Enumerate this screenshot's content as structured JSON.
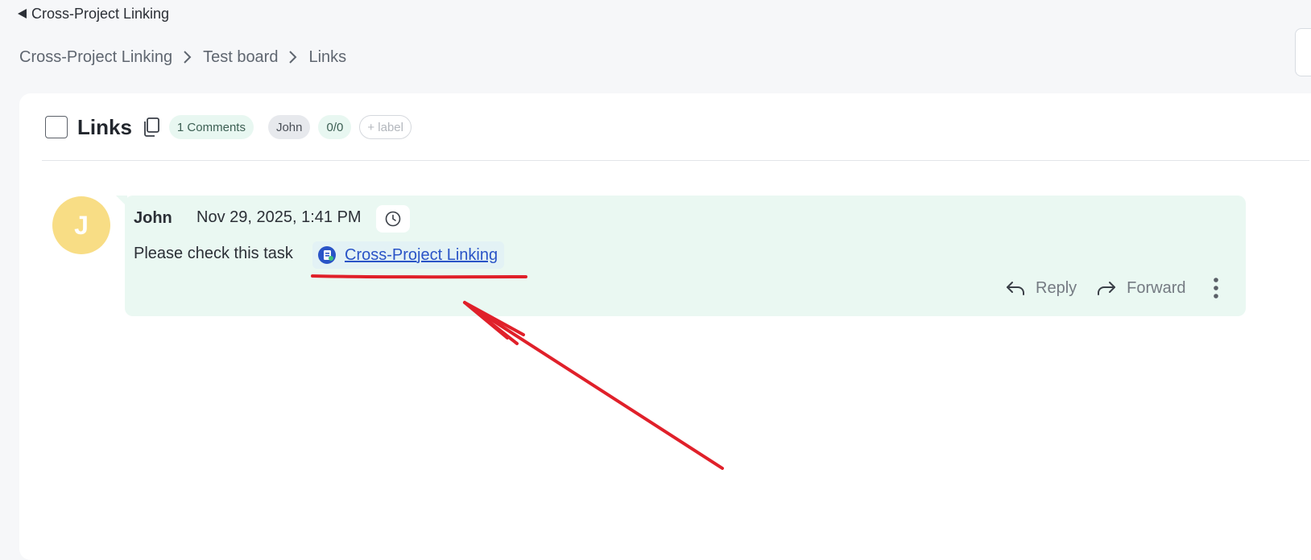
{
  "back_link": {
    "label": "Cross-Project Linking"
  },
  "breadcrumb": [
    {
      "label": "Cross-Project Linking"
    },
    {
      "label": "Test board"
    },
    {
      "label": "Links"
    }
  ],
  "task": {
    "title": "Links",
    "comments_badge": "1 Comments",
    "assignee_badge": "John",
    "checklist_badge": "0/0",
    "add_label": "+ label"
  },
  "comment": {
    "avatar_initial": "J",
    "author": "John",
    "timestamp": "Nov 29, 2025, 1:41 PM",
    "text": "Please check this task",
    "link_label": "Cross-Project Linking",
    "actions": {
      "reply": "Reply",
      "forward": "Forward"
    }
  },
  "colors": {
    "accent_green_bg": "#eaf8f2",
    "avatar_bg": "#f8dd85",
    "link": "#2a54c7",
    "annotation_red": "#e0202a"
  },
  "icons": [
    "back-triangle-icon",
    "chevron-right-icon",
    "copy-icon",
    "clock-icon",
    "project-icon",
    "reply-icon",
    "forward-icon",
    "more-vertical-icon"
  ]
}
